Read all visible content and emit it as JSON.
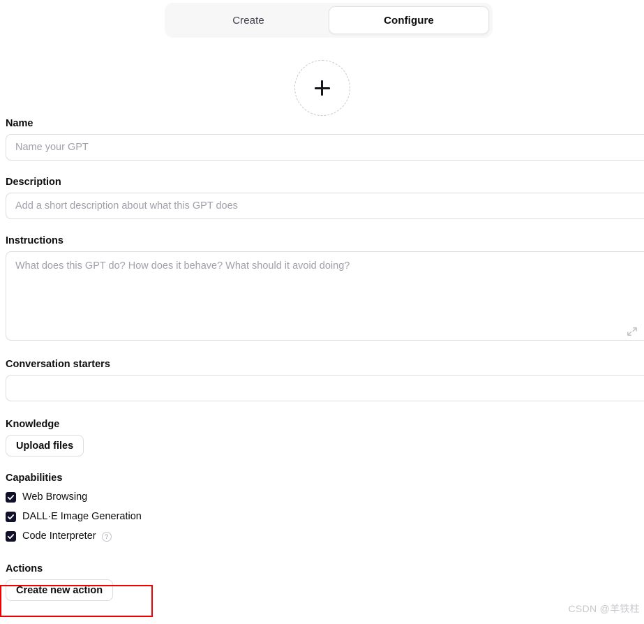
{
  "tabs": [
    {
      "label": "Create",
      "active": false
    },
    {
      "label": "Configure",
      "active": true
    }
  ],
  "avatar": {
    "icon": "plus-icon",
    "alt": "Upload GPT profile picture"
  },
  "fields": {
    "name": {
      "label": "Name",
      "placeholder": "Name your GPT",
      "value": ""
    },
    "description": {
      "label": "Description",
      "placeholder": "Add a short description about what this GPT does",
      "value": ""
    },
    "instructions": {
      "label": "Instructions",
      "placeholder": "What does this GPT do? How does it behave? What should it avoid doing?",
      "value": "",
      "resize_icon": "expand-diagonal-icon"
    },
    "conversation_starters": {
      "label": "Conversation starters",
      "placeholder": "",
      "value": "",
      "remove_icon": "close-icon"
    }
  },
  "knowledge": {
    "label": "Knowledge",
    "upload_button": "Upload files"
  },
  "capabilities": {
    "label": "Capabilities",
    "items": [
      {
        "label": "Web Browsing",
        "checked": true,
        "help": false
      },
      {
        "label": "DALL·E Image Generation",
        "checked": true,
        "help": false
      },
      {
        "label": "Code Interpreter",
        "checked": true,
        "help": true,
        "help_glyph": "?"
      }
    ]
  },
  "actions": {
    "label": "Actions",
    "create_button": "Create new action"
  },
  "annotation": {
    "type": "highlight-rectangle",
    "target": "create-new-action-button",
    "color": "#ef0000"
  },
  "watermark": {
    "text": "CSDN @羊铁柱"
  },
  "colors": {
    "accent": "#10102a",
    "annotation": "#ef0000",
    "tab_track": "#f7f7f8",
    "border": "#dcdce0",
    "placeholder": "#a0a0ab"
  }
}
